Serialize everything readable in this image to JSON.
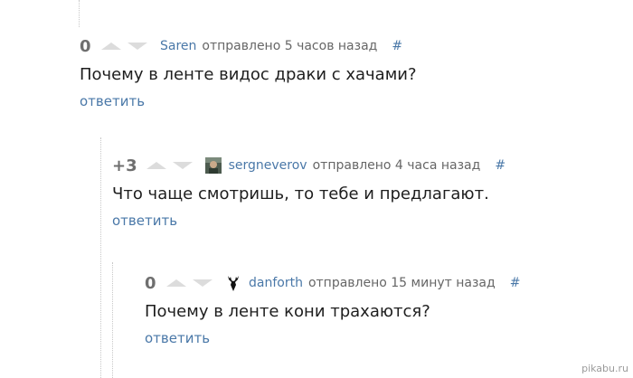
{
  "comments": [
    {
      "score": "0",
      "author": "Saren",
      "sent": "отправлено 5 часов назад",
      "hash": "#",
      "text": "Почему в ленте видос драки с хачами?",
      "reply": "ответить",
      "avatar": null
    },
    {
      "score": "+3",
      "author": "sergneverov",
      "sent": "отправлено 4 часа назад",
      "hash": "#",
      "text": "Что чаще смотришь, то тебе и предлагают.",
      "reply": "ответить",
      "avatar": "user-photo-avatar"
    },
    {
      "score": "0",
      "author": "danforth",
      "sent": "отправлено 15 минут назад",
      "hash": "#",
      "text": "Почему в ленте кони трахаются?",
      "reply": "ответить",
      "avatar": "deer-head-avatar"
    }
  ],
  "watermark": "pikabu.ru",
  "colors": {
    "link": "#4a78a8",
    "score": "#6f6f6f",
    "vote": "#dcdcdc",
    "text": "#1e1e1e"
  }
}
